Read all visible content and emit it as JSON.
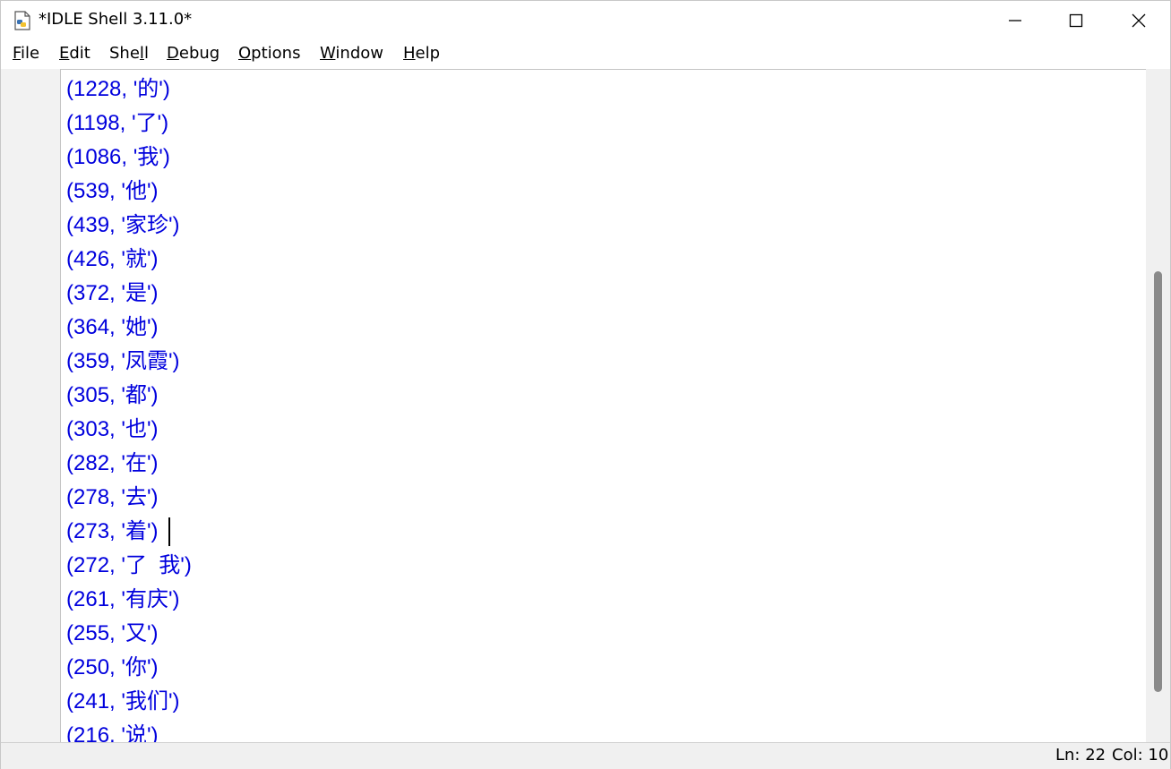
{
  "window": {
    "title": "*IDLE Shell 3.11.0*",
    "icon": "python-idle-icon"
  },
  "menu": [
    {
      "label_mnemonic": "F",
      "label_rest": "ile"
    },
    {
      "label_mnemonic": "E",
      "label_rest": "dit"
    },
    {
      "label_pre": "She",
      "label_mnemonic": "l",
      "label_rest": "l"
    },
    {
      "label_mnemonic": "D",
      "label_rest": "ebug"
    },
    {
      "label_mnemonic": "O",
      "label_rest": "ptions"
    },
    {
      "label_mnemonic": "W",
      "label_rest": "indow"
    },
    {
      "label_mnemonic": "H",
      "label_rest": "elp"
    }
  ],
  "output_lines": [
    "(1228, '的')",
    "(1198, '了')",
    "(1086, '我')",
    "(539, '他')",
    "(439, '家珍')",
    "(426, '就')",
    "(372, '是')",
    "(364, '她')",
    "(359, '凤霞')",
    "(305, '都')",
    "(303, '也')",
    "(282, '在')",
    "(278, '去')",
    "(273, '着')",
    "(272, '了  我')",
    "(261, '有庆')",
    "(255, '又')",
    "(250, '你')",
    "(241, '我们')",
    "(216, '说')"
  ],
  "status": {
    "line": "Ln: 22",
    "col": "Col: 10"
  },
  "colors": {
    "output_text": "#0000dd"
  }
}
